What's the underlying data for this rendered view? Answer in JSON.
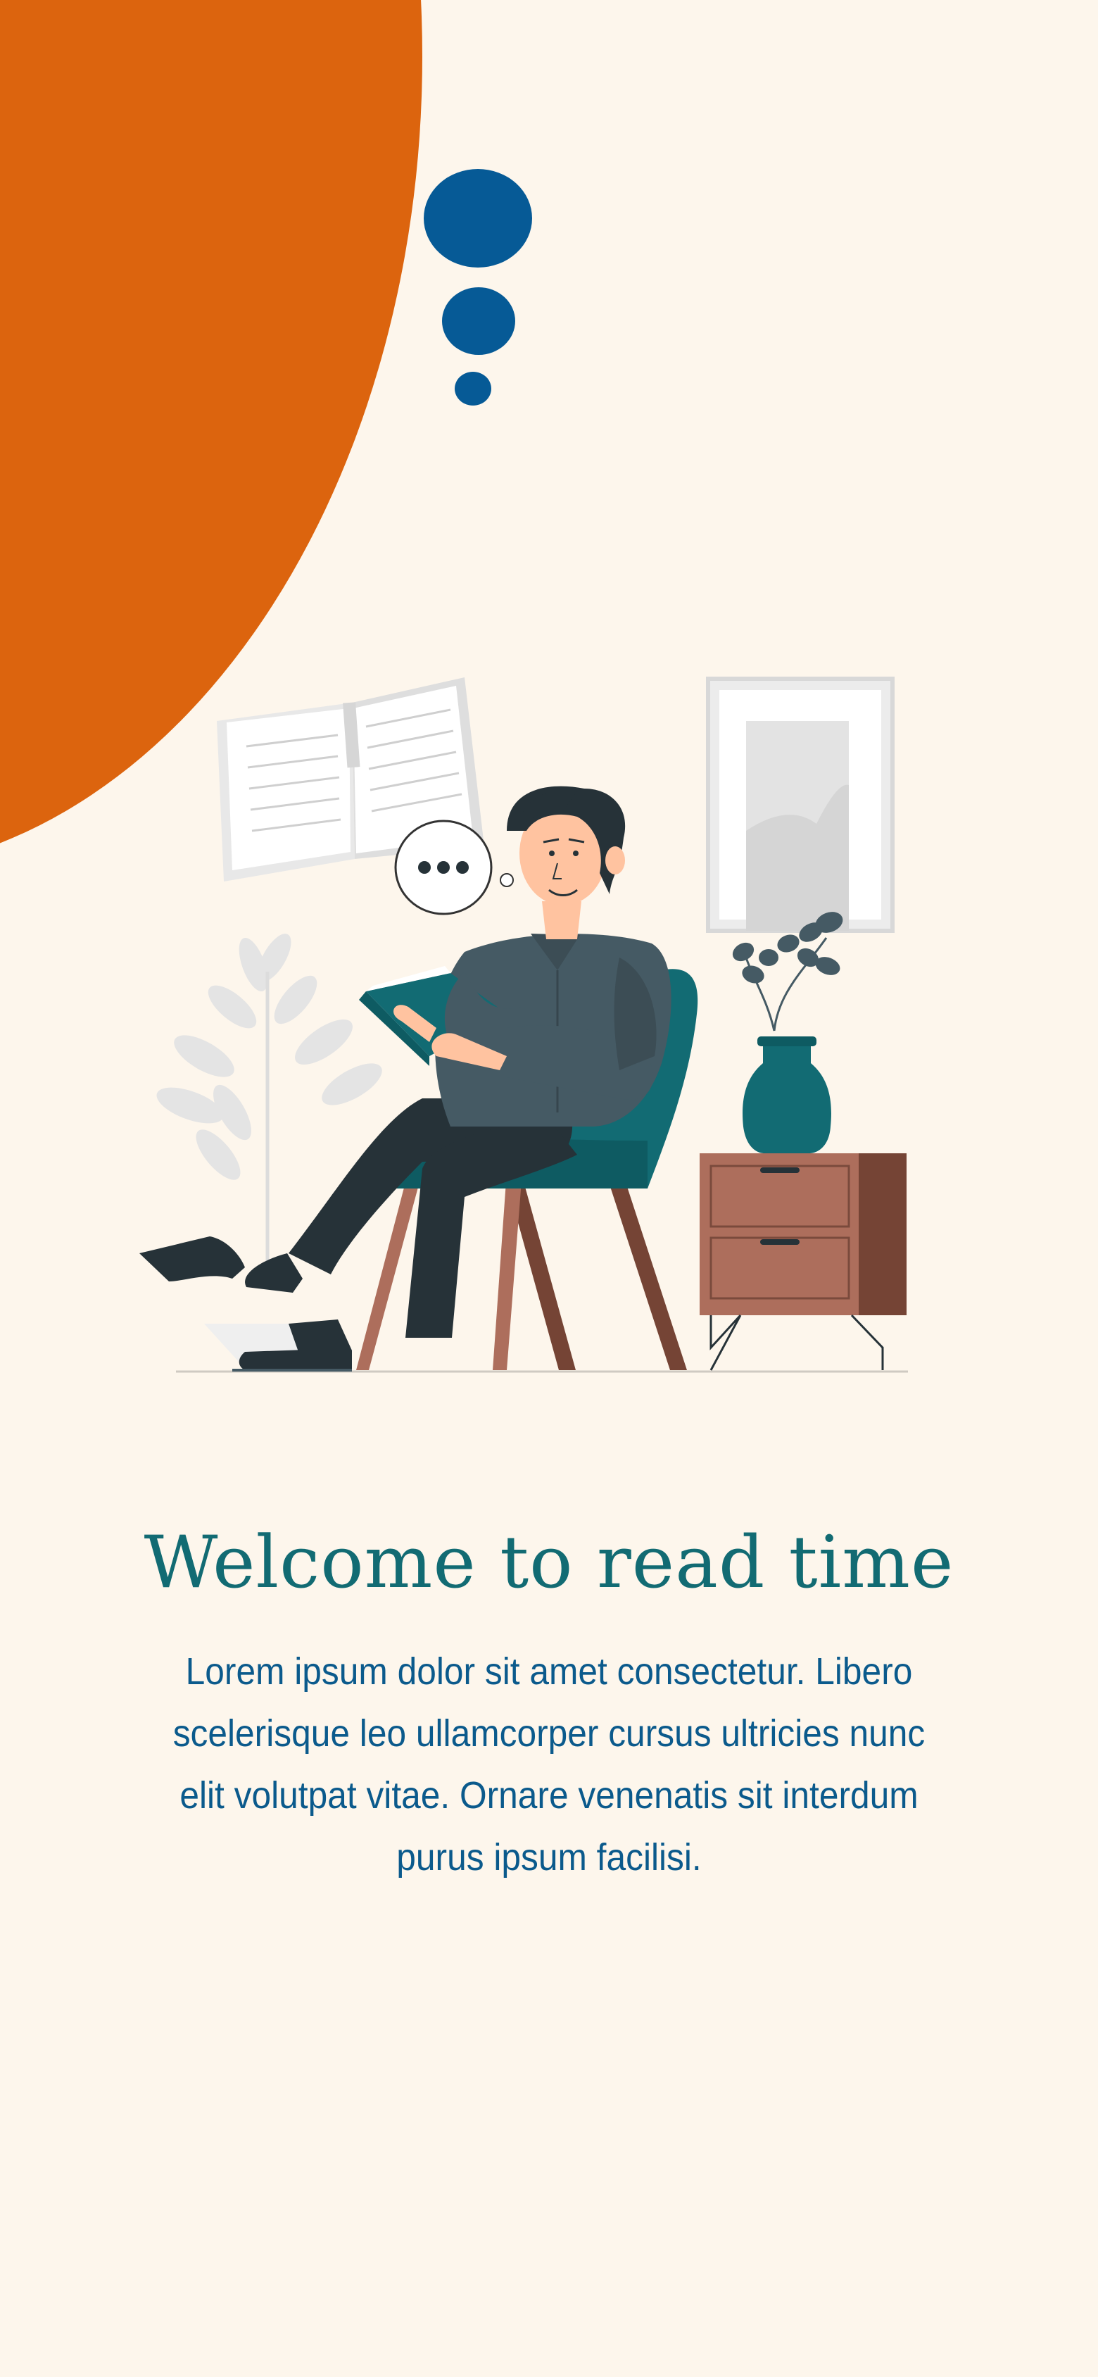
{
  "onboarding": {
    "title": "Welcome to read time",
    "description": "Lorem ipsum dolor sit amet consectetur. Libero scelerisque leo ullamcorper cursus ultricies nunc elit volutpat vitae. Ornare venenatis sit interdum purus ipsum facilisi."
  },
  "colors": {
    "background": "#fdf6ec",
    "accent_orange": "#dc640e",
    "bubble_blue": "#065a96",
    "title_teal": "#126b73",
    "text_blue": "#0b5a8c"
  },
  "illustration": {
    "name": "man-reading-in-armchair-illustration",
    "elements": [
      "open-book-icon",
      "thought-bubble-icon",
      "picture-frame",
      "plant",
      "vase",
      "nightstand",
      "armchair"
    ]
  }
}
